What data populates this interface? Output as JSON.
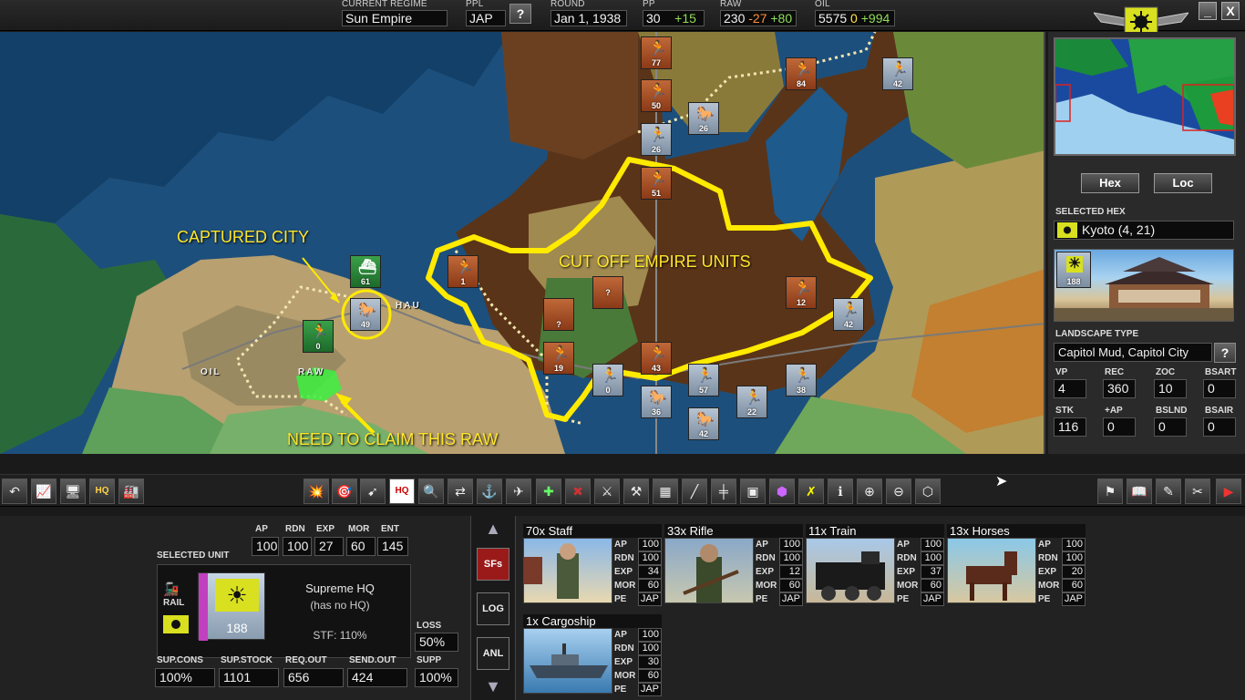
{
  "topbar": {
    "regime_label": "CURRENT REGIME",
    "regime_value": "Sun Empire",
    "ppl_label": "PPL",
    "ppl_value": "JAP",
    "round_label": "ROUND",
    "round_value": "Jan 1, 1938",
    "pp_label": "PP",
    "pp_value": "30",
    "pp_delta": "+15",
    "raw_label": "RAW",
    "raw_value": "230",
    "raw_delta_neg": "-27",
    "raw_delta_pos": "+80",
    "oil_label": "OIL",
    "oil_value": "5575",
    "oil_delta_zero": "0",
    "oil_delta_pos": "+994",
    "help_label": "?"
  },
  "window": {
    "minimize_label": "_",
    "close_label": "X"
  },
  "map": {
    "annotations": {
      "captured_city": "CAPTURED CITY",
      "cut_off": "CUT OFF EMPIRE UNITS",
      "need_raw": "NEED TO CLAIM THIS RAW"
    },
    "place_labels": {
      "oil": "OIL",
      "raw": "RAW",
      "hau": "HAU"
    },
    "units": [
      {
        "v": "77"
      },
      {
        "v": "50"
      },
      {
        "v": "26"
      },
      {
        "v": "84"
      },
      {
        "v": "42"
      },
      {
        "v": "26"
      },
      {
        "v": "51"
      },
      {
        "v": "1"
      },
      {
        "v": "?"
      },
      {
        "v": "?"
      },
      {
        "v": "12"
      },
      {
        "v": "42"
      },
      {
        "v": "19"
      },
      {
        "v": "43"
      },
      {
        "v": "0"
      },
      {
        "v": "57"
      },
      {
        "v": "38"
      },
      {
        "v": "36"
      },
      {
        "v": "22"
      },
      {
        "v": "42"
      },
      {
        "v": "61"
      },
      {
        "v": "49"
      },
      {
        "v": "0"
      }
    ]
  },
  "right_panel": {
    "hex_btn": "Hex",
    "loc_btn": "Loc",
    "selected_hex_label": "SELECTED HEX",
    "selected_hex_value": "Kyoto (4, 21)",
    "hex_unit_value": "188",
    "landscape_label": "LANDSCAPE TYPE",
    "landscape_value": "Capitol Mud, Capitol City",
    "landscape_help": "?",
    "stats_row1": [
      {
        "label": "VP",
        "value": "4"
      },
      {
        "label": "REC",
        "value": "360"
      },
      {
        "label": "ZOC",
        "value": "10"
      },
      {
        "label": "BSART",
        "value": "0"
      }
    ],
    "stats_row2": [
      {
        "label": "STK",
        "value": "116"
      },
      {
        "label": "+AP",
        "value": "0"
      },
      {
        "label": "BSLND",
        "value": "0"
      },
      {
        "label": "BSAIR",
        "value": "0"
      }
    ]
  },
  "bottom": {
    "selected_unit_label": "SELECTED UNIT",
    "top_stats": [
      {
        "label": "AP",
        "value": "100"
      },
      {
        "label": "RDN",
        "value": "100"
      },
      {
        "label": "EXP",
        "value": "27"
      },
      {
        "label": "MOR",
        "value": "60"
      },
      {
        "label": "ENT",
        "value": "145"
      }
    ],
    "unit_mode": "RAIL",
    "unit_strength": "188",
    "unit_name": "Supreme HQ",
    "unit_hq": "(has no HQ)",
    "unit_stf": "STF: 110%",
    "loss_label": "LOSS",
    "loss_value": "50%",
    "supply": [
      {
        "label": "SUP.CONS",
        "value": "100%"
      },
      {
        "label": "SUP.STOCK",
        "value": "1101"
      },
      {
        "label": "REQ.OUT",
        "value": "656"
      },
      {
        "label": "SEND.OUT",
        "value": "424"
      },
      {
        "label": "SUPP",
        "value": "100%"
      }
    ],
    "side_buttons": {
      "sfs": "SFs",
      "log": "LOG",
      "anl": "ANL"
    },
    "troops": [
      {
        "title": "70x Staff",
        "ap": "100",
        "rdn": "100",
        "exp": "34",
        "mor": "60",
        "pe": "JAP"
      },
      {
        "title": "33x Rifle",
        "ap": "100",
        "rdn": "100",
        "exp": "12",
        "mor": "60",
        "pe": "JAP"
      },
      {
        "title": "11x Train",
        "ap": "100",
        "rdn": "100",
        "exp": "37",
        "mor": "60",
        "pe": "JAP"
      },
      {
        "title": "13x Horses",
        "ap": "100",
        "rdn": "100",
        "exp": "20",
        "mor": "60",
        "pe": "JAP"
      },
      {
        "title": "1x Cargoship",
        "ap": "100",
        "rdn": "100",
        "exp": "30",
        "mor": "60",
        "pe": "JAP"
      }
    ],
    "stat_keys": {
      "ap": "AP",
      "rdn": "RDN",
      "exp": "EXP",
      "mor": "MOR",
      "pe": "PE"
    }
  },
  "toolbar": {
    "hq_label": "HQ"
  }
}
